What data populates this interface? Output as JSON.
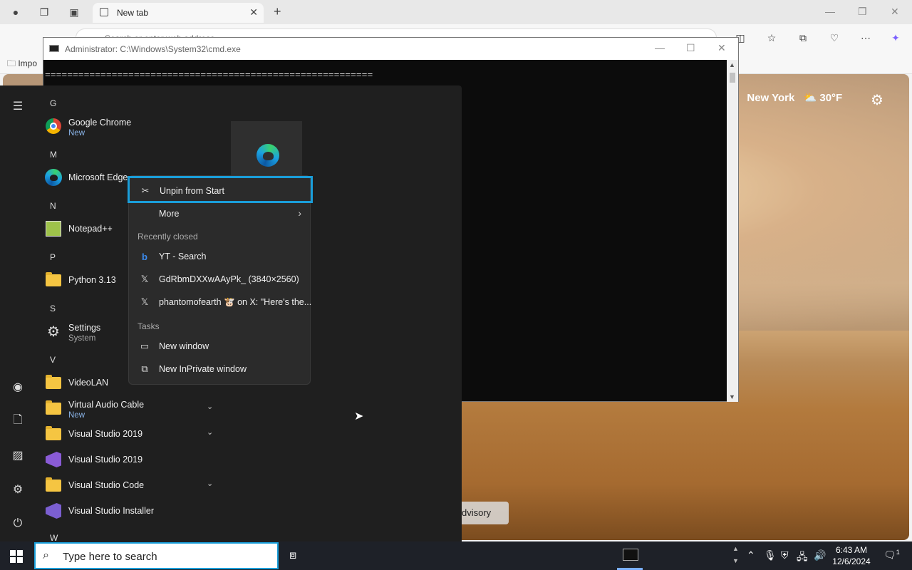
{
  "browser": {
    "tab_title": "New tab",
    "address_placeholder": "Search or enter web address",
    "favorites_item": "Impo",
    "weather_city_partial": "rk",
    "weather_city": "New York",
    "weather_temp": "30°F",
    "advisory_label": "dvisory"
  },
  "cmd": {
    "title": "Administrator: C:\\Windows\\System32\\cmd.exe",
    "line1": "==========================================================="
  },
  "start_menu": {
    "groups": [
      {
        "letter": "G"
      },
      {
        "letter": "M"
      },
      {
        "letter": "N"
      },
      {
        "letter": "P"
      },
      {
        "letter": "S"
      },
      {
        "letter": "V"
      },
      {
        "letter": "W"
      }
    ],
    "apps": {
      "chrome": {
        "name": "Google Chrome",
        "sub": "New"
      },
      "edge": {
        "name": "Microsoft Edge"
      },
      "notepadpp": {
        "name": "Notepad++"
      },
      "python": {
        "name": "Python 3.13"
      },
      "settings": {
        "name": "Settings",
        "sub": "System"
      },
      "videolan": {
        "name": "VideoLAN"
      },
      "vac": {
        "name": "Virtual Audio Cable",
        "sub": "New"
      },
      "vs2019_folder": {
        "name": "Visual Studio 2019"
      },
      "vs2019": {
        "name": "Visual Studio 2019"
      },
      "vscode": {
        "name": "Visual Studio Code"
      },
      "vsinstaller": {
        "name": "Visual Studio Installer"
      }
    }
  },
  "context_menu": {
    "unpin": "Unpin from Start",
    "more": "More",
    "recently_closed_header": "Recently closed",
    "recent": [
      "YT - Search",
      "GdRbmDXXwAAyPk_ (3840×2560)",
      "phantomofearth 🐮 on X: \"Here's the..."
    ],
    "tasks_header": "Tasks",
    "new_window": "New window",
    "new_inprivate": "New InPrivate window"
  },
  "taskbar": {
    "search_placeholder": "Type here to search",
    "time": "6:43 AM",
    "date": "12/6/2024",
    "notification_count": "1"
  },
  "colors": {
    "accent": "#1a9ed9",
    "start_bg": "#1f1f1f",
    "context_bg": "#2b2b2b"
  }
}
